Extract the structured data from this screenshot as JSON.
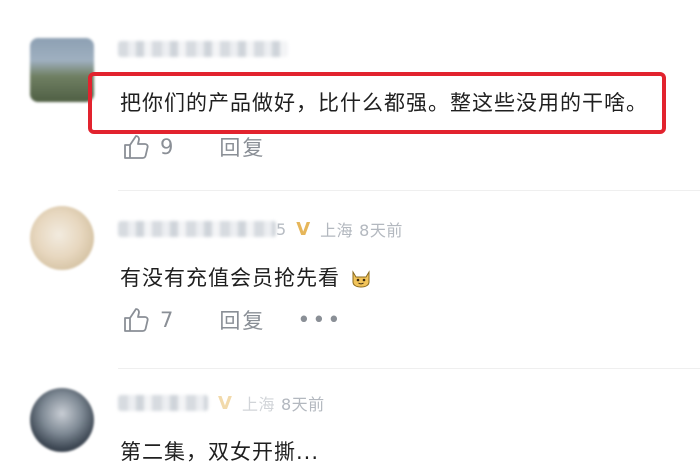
{
  "comments": [
    {
      "text": "把你们的产品做好，比什么都强。整这些没用的干啥。",
      "likes": "9",
      "reply_label": "回复"
    },
    {
      "name_tail": "5",
      "location": "上海",
      "time": "8天前",
      "text": "有没有充值会员抢先看",
      "likes": "7",
      "reply_label": "回复"
    },
    {
      "location": "上海",
      "time": "8天前",
      "text": "第二集，双女开撕..."
    }
  ],
  "colors": {
    "highlight": "#e2232e",
    "vip": "#e6b65a",
    "meta": "#b3b8bf",
    "action": "#8a8f96"
  }
}
